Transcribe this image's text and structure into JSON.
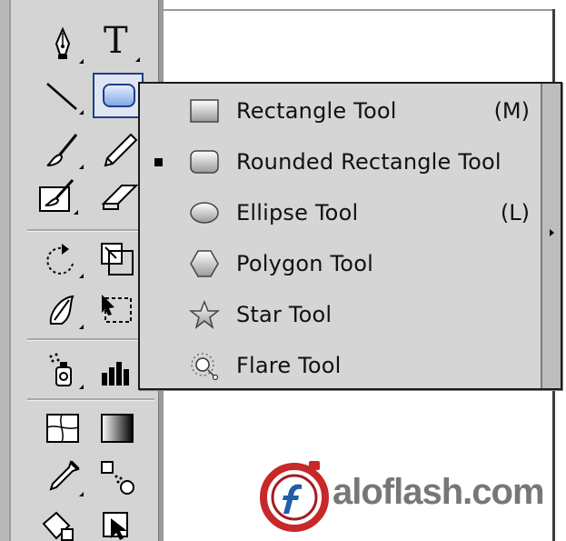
{
  "flyout": {
    "items": [
      {
        "label": "Rectangle Tool",
        "shortcut": "(M)",
        "checked": false,
        "icon": "rectangle-icon"
      },
      {
        "label": "Rounded Rectangle Tool",
        "shortcut": "",
        "checked": true,
        "icon": "rounded-rectangle-icon"
      },
      {
        "label": "Ellipse Tool",
        "shortcut": "(L)",
        "checked": false,
        "icon": "ellipse-icon"
      },
      {
        "label": "Polygon Tool",
        "shortcut": "",
        "checked": false,
        "icon": "polygon-icon"
      },
      {
        "label": "Star Tool",
        "shortcut": "",
        "checked": false,
        "icon": "star-icon"
      },
      {
        "label": "Flare Tool",
        "shortcut": "",
        "checked": false,
        "icon": "flare-icon"
      }
    ]
  },
  "toolbar": {
    "type_tool_glyph": "T",
    "tools": [
      "pen-icon",
      "type-icon",
      "line-segment-icon",
      "rounded-rectangle-icon",
      "paintbrush-icon",
      "pencil-icon",
      "blob-brush-icon",
      "eraser-icon",
      "rotate-icon",
      "scale-icon",
      "warp-icon",
      "free-transform-icon",
      "symbol-sprayer-icon",
      "column-graph-icon",
      "mesh-icon",
      "gradient-icon",
      "eyedropper-icon",
      "blend-icon",
      "live-paint-bucket-icon",
      "live-paint-selection-icon"
    ]
  },
  "watermark": {
    "text": "aloflash.com",
    "accent": "#c8282a"
  },
  "colors": {
    "menu_bg": "#d5d5d5",
    "toolbar_bg": "#d4d4d4",
    "selected_border": "#1e3f8a"
  }
}
